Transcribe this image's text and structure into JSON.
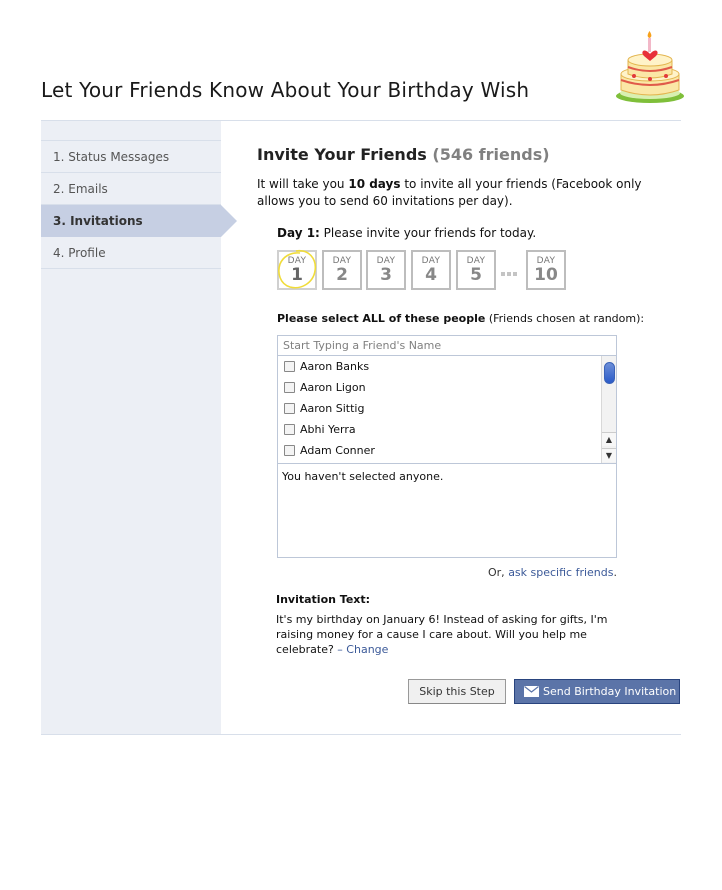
{
  "page": {
    "title": "Let Your Friends Know About Your Birthday Wish"
  },
  "steps": [
    {
      "label": "1. Status Messages",
      "active": false
    },
    {
      "label": "2. Emails",
      "active": false
    },
    {
      "label": "3. Invitations",
      "active": true
    },
    {
      "label": "4. Profile",
      "active": false
    }
  ],
  "main": {
    "heading": "Invite Your Friends",
    "friend_count": "(546 friends)",
    "intro_before": "It will take you ",
    "intro_bold": "10 days",
    "intro_after": " to invite all your friends (Facebook only allows you to send 60 invitations per day).",
    "day_prefix": "Day 1:",
    "day_text": " Please invite your friends for today.",
    "days": [
      {
        "label": "DAY",
        "number": "1"
      },
      {
        "label": "DAY",
        "number": "2"
      },
      {
        "label": "DAY",
        "number": "3"
      },
      {
        "label": "DAY",
        "number": "4"
      },
      {
        "label": "DAY",
        "number": "5"
      },
      {
        "label": "DAY",
        "number": "10"
      }
    ],
    "select_bold": "Please select ALL of these people",
    "select_rest": " (Friends chosen at random):",
    "search_placeholder": "Start Typing a Friend's Name",
    "friends": [
      "Aaron Banks",
      "Aaron Ligon",
      "Aaron Sittig",
      "Abhi Yerra",
      "Adam Conner"
    ],
    "selected_text": "You haven't selected anyone.",
    "ask_prefix": "Or, ",
    "ask_link": "ask specific friends",
    "ask_suffix": ".",
    "invitation_title": "Invitation Text:",
    "invitation_body": "It's my birthday on January 6! Instead of asking for gifts, I'm raising money for a cause I care about. Will you help me celebrate?",
    "invitation_change": " – Change",
    "skip_label": "Skip this Step",
    "send_label": "Send Birthday Invitation"
  },
  "colors": {
    "accent": "#3b5998",
    "sidebar_bg": "#eceff5",
    "active_step": "#c6cfe3",
    "circle": "#f3e04a"
  },
  "icons": [
    "birthday-cake-icon",
    "checkbox-icon",
    "scroll-up-icon",
    "scroll-down-icon",
    "envelope-icon"
  ]
}
